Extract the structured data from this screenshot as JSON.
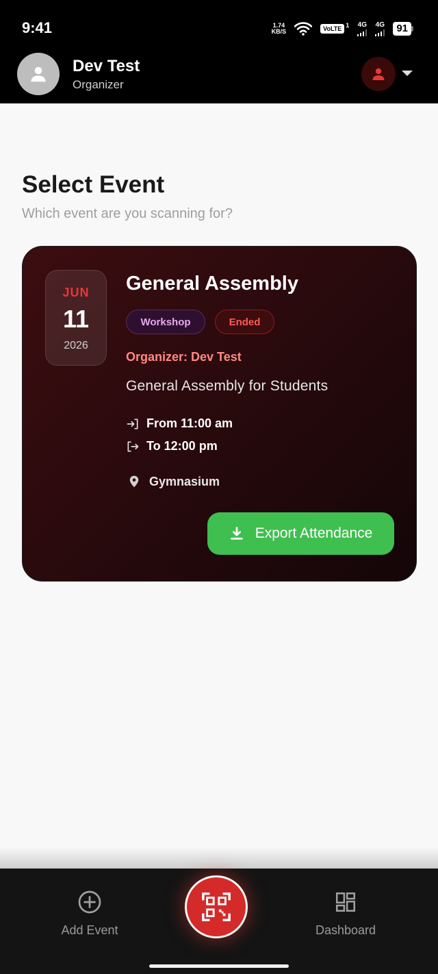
{
  "status_bar": {
    "time": "9:41",
    "net_speed_value": "1.74",
    "net_speed_unit": "KB/S",
    "volte": "VoLTE",
    "sim1_label": "1",
    "sig1_label": "4G",
    "sig2_label": "4G",
    "battery": "91"
  },
  "header": {
    "user_name": "Dev Test",
    "user_role": "Organizer",
    "avatar_icon": "person-icon",
    "profile_icon": "person-icon",
    "accent_color": "#e53935"
  },
  "page": {
    "title": "Select Event",
    "subtitle": "Which event are you scanning for?"
  },
  "event": {
    "month": "JUN",
    "day": "11",
    "year": "2026",
    "title": "General Assembly",
    "type_tag": "Workshop",
    "status_tag": "Ended",
    "organizer": "Organizer: Dev Test",
    "description": "General Assembly for Students",
    "time_from": "From 11:00 am",
    "time_to": "To 12:00 pm",
    "location": "Gymnasium",
    "export_label": "Export Attendance",
    "export_color": "#3fbf4f"
  },
  "bottom_nav": {
    "add_label": "Add Event",
    "dashboard_label": "Dashboard",
    "scan_icon": "qr-scan-icon",
    "scan_color": "#d42a2a"
  }
}
